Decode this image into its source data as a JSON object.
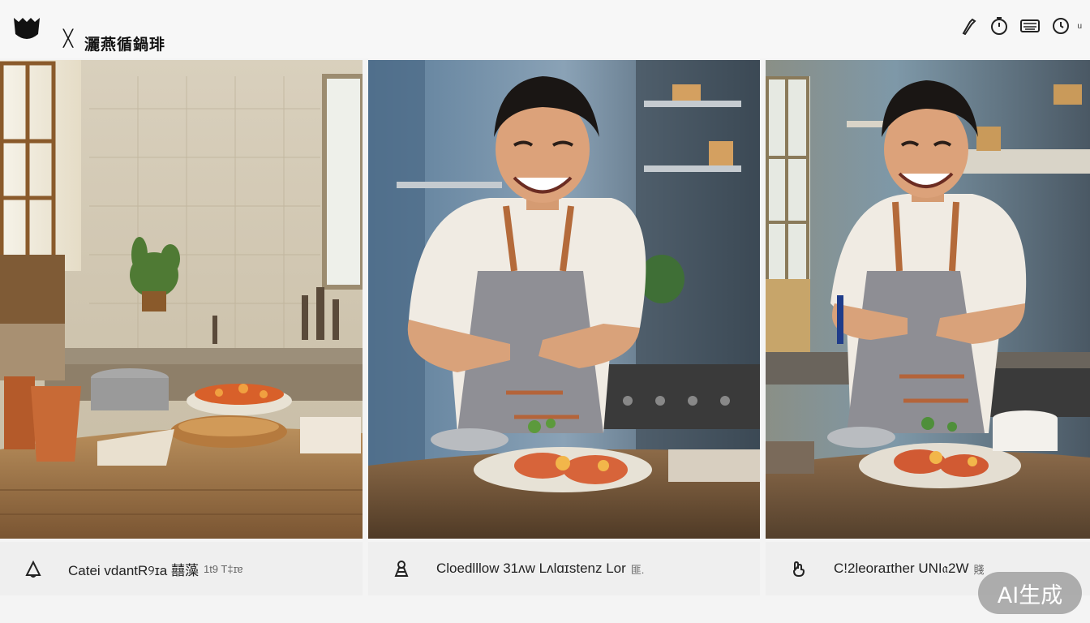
{
  "header": {
    "title": "灑燕循鍋琲",
    "close_glyph": "╳",
    "logo_icon": "shield-logo-icon",
    "right_icons": [
      "wrench-icon",
      "timer-icon",
      "keyboard-icon",
      "clock-icon"
    ],
    "right_suffix": "u"
  },
  "panels": [
    {
      "icon": "bell-icon",
      "caption": "Catei vdantR୨ɪa 囍藻",
      "caption_extra": "1t9 T‡ɪɐ"
    },
    {
      "icon": "chef-icon",
      "caption": "Cloedlllow 31ʌw Lʌlɑɪstenz Lor",
      "caption_extra": "匪."
    },
    {
      "icon": "hand-icon",
      "caption": "C!2leoraɪther UNI𝔞2W",
      "caption_extra": "賤"
    }
  ],
  "badge": {
    "label": "AI生成"
  },
  "colors": {
    "header_bg": "#f7f7f7",
    "caption_bg": "#efefef",
    "badge_bg": "#969696"
  }
}
